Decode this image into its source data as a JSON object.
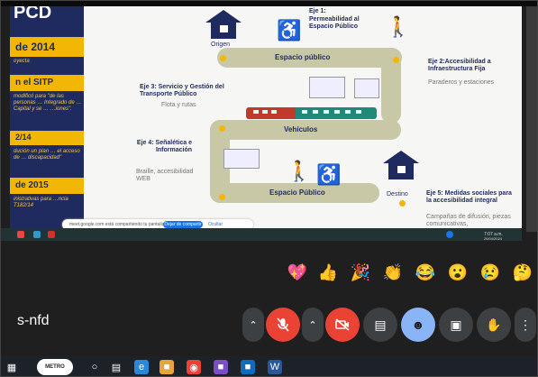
{
  "slide": {
    "left_title": "PCD",
    "left_box1": "de 2014",
    "left_small1": "oyecta",
    "left_box2": "n el SITP",
    "left_small2": "modificó para \"de las personas … Integrado de … Capital y se … …iones\".",
    "left_box3": "2/14",
    "left_small3": "dución un plan … el acceso de … discapacidad\"",
    "left_box4": "de 2015",
    "left_small4": "inistrativas para …ncia T182/14",
    "origen": "Origen",
    "eje1": "Eje 1:",
    "eje1_sub": "Permeabilidad al Espacio Público",
    "eje2": "Eje 2:Accesibilidad a Infraestructura Fija",
    "eje2_sub": "Paraderos y estaciones",
    "eje3": "Eje 3: Servicio y Gestión del Transporte Público",
    "eje3_sub": "Flota y rutas",
    "eje4": "Eje 4: Señalética e Información",
    "eje4_sub": "Braille, accesibilidad WEB",
    "eje5": "Eje 5: Medidas sociales para la accesibilidad integral",
    "eje5_sub": "Campañas de difusión, piezas comunicativas,",
    "destino": "Destino",
    "road_top": "Espacio público",
    "road_mid": "Vehículos",
    "road_bottom": "Espacio Público",
    "share_msg": "meet.google.com está compartiendo tu pantalla.",
    "share_btn": "Dejar de compartir",
    "dismiss": "Ocultar"
  },
  "inner_taskbar": {
    "center_text": "",
    "time": "7:07 a.m.",
    "date": "26/04/2024"
  },
  "reactions": [
    "💖",
    "👍",
    "🎉",
    "👏",
    "😂",
    "😮",
    "😢",
    "🤔"
  ],
  "meeting": {
    "name": "s-nfd"
  },
  "controls": {
    "mic": "mic-off",
    "cam": "cam-off"
  },
  "colors": {
    "navy": "#1f2a5f",
    "gold": "#f2b705",
    "green": "#2fa84f",
    "red": "#ea4335",
    "blue": "#8ab4f8"
  },
  "taskbar": {
    "logo_text": "METRO"
  }
}
